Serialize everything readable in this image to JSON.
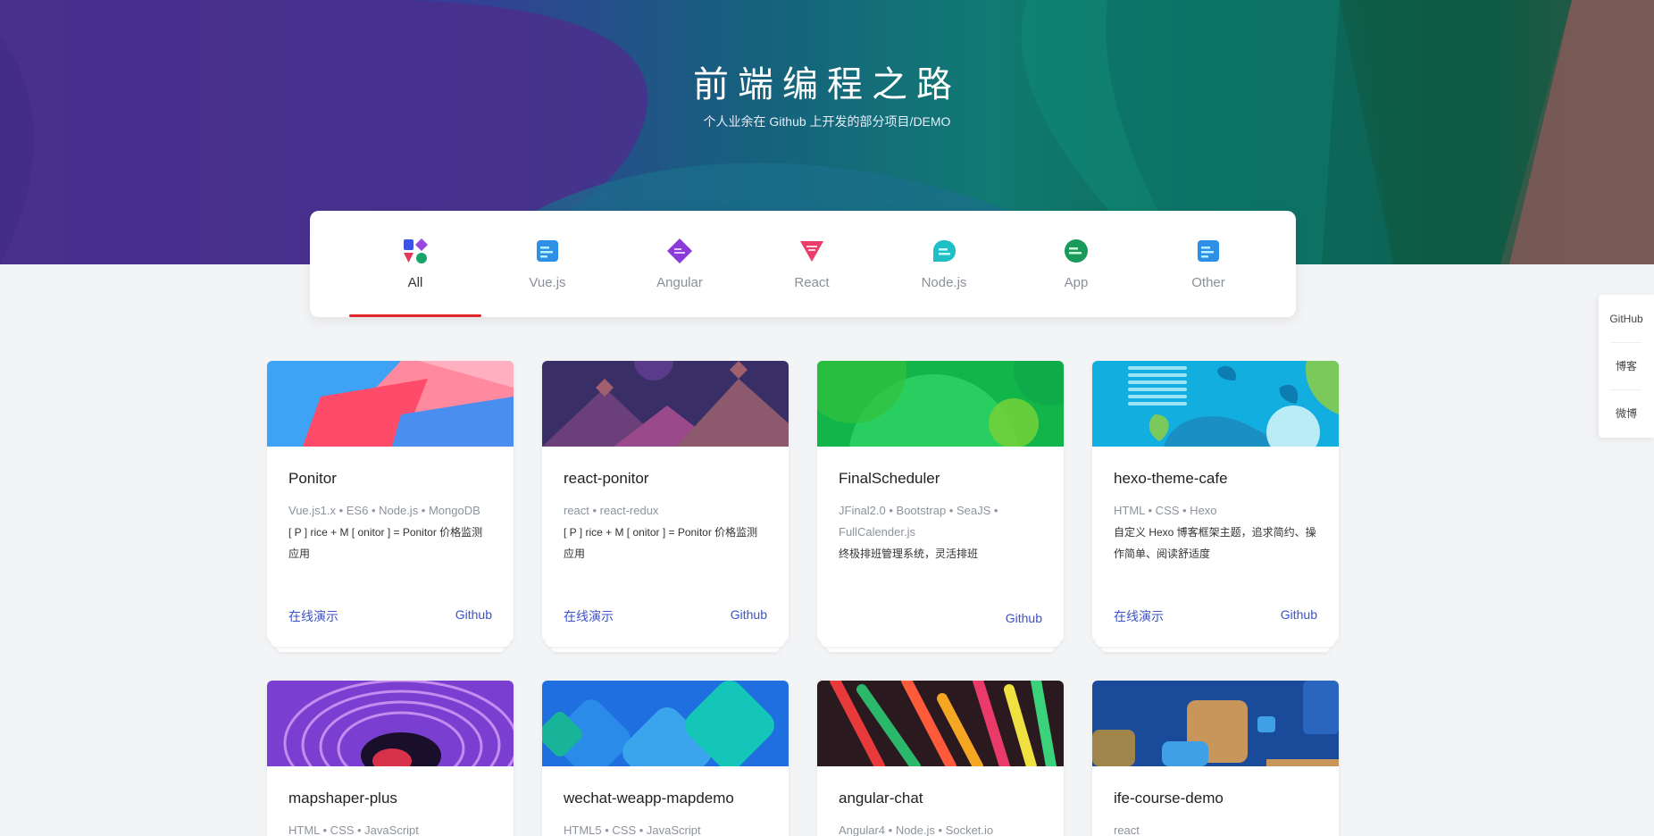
{
  "hero": {
    "title": "前端编程之路",
    "subtitle": "个人业余在 Github 上开发的部分项目/DEMO"
  },
  "tabs": [
    {
      "label": "All",
      "icon": "all-shapes-icon",
      "active": true
    },
    {
      "label": "Vue.js",
      "icon": "vue-doc-icon",
      "active": false
    },
    {
      "label": "Angular",
      "icon": "angular-diamond-icon",
      "active": false
    },
    {
      "label": "React",
      "icon": "react-triangle-icon",
      "active": false
    },
    {
      "label": "Node.js",
      "icon": "node-chat-icon",
      "active": false
    },
    {
      "label": "App",
      "icon": "app-circle-icon",
      "active": false
    },
    {
      "label": "Other",
      "icon": "other-doc-icon",
      "active": false
    }
  ],
  "side": {
    "github": "GitHub",
    "blog": "博客",
    "weibo": "微博"
  },
  "projects": [
    {
      "title": "Ponitor",
      "tags": "Vue.js1.x • ES6 • Node.js • MongoDB",
      "desc": "[ P ] rice + M [ onitor ] = Ponitor 价格监测应用",
      "demo": "在线演示",
      "github": "Github"
    },
    {
      "title": "react-ponitor",
      "tags": "react • react-redux",
      "desc": "[ P ] rice + M [ onitor ] = Ponitor 价格监测应用",
      "demo": "在线演示",
      "github": "Github"
    },
    {
      "title": "FinalScheduler",
      "tags": "JFinal2.0 • Bootstrap • SeaJS • FullCalender.js",
      "desc": "终极排班管理系统，灵活排班",
      "demo": "",
      "github": "Github"
    },
    {
      "title": "hexo-theme-cafe",
      "tags": "HTML • CSS • Hexo",
      "desc": "自定义 Hexo 博客框架主题，追求简约、操作简单、阅读舒适度",
      "demo": "在线演示",
      "github": "Github"
    },
    {
      "title": "mapshaper-plus",
      "tags": "HTML • CSS • JavaScript",
      "desc": "",
      "demo": "",
      "github": ""
    },
    {
      "title": "wechat-weapp-mapdemo",
      "tags": "HTML5 • CSS • JavaScript",
      "desc": "",
      "demo": "",
      "github": ""
    },
    {
      "title": "angular-chat",
      "tags": "Angular4 • Node.js • Socket.io",
      "desc": "",
      "demo": "",
      "github": ""
    },
    {
      "title": "ife-course-demo",
      "tags": "react",
      "desc": "",
      "demo": "",
      "github": ""
    }
  ],
  "colors": {
    "accent": "#e0262a",
    "link": "#3b52c9",
    "background": "#f3f4f6"
  }
}
